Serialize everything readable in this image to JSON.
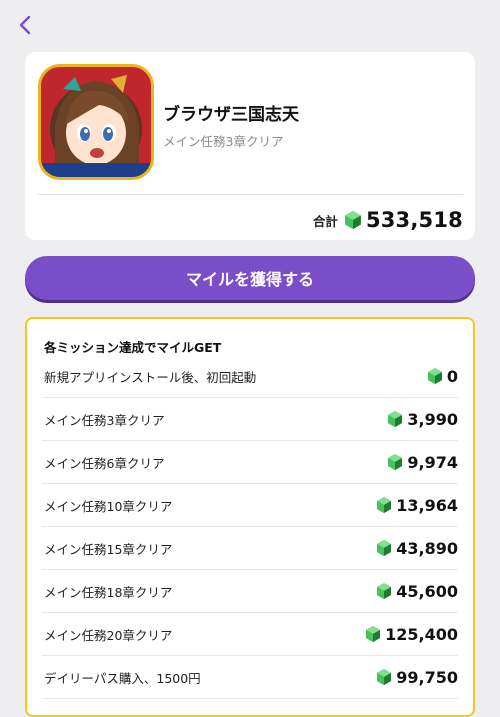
{
  "app": {
    "name": "ブラウザ三国志天",
    "subtitle": "メイン任務3章クリア",
    "total_label": "合計",
    "total_value": "533,518"
  },
  "earn_button": {
    "label": "マイルを獲得する"
  },
  "missions": {
    "title": "各ミッション達成でマイルGET",
    "items": [
      {
        "label": "新規アプリインストール後、初回起動",
        "value": "0"
      },
      {
        "label": "メイン任務3章クリア",
        "value": "3,990"
      },
      {
        "label": "メイン任務6章クリア",
        "value": "9,974"
      },
      {
        "label": "メイン任務10章クリア",
        "value": "13,964"
      },
      {
        "label": "メイン任務15章クリア",
        "value": "43,890"
      },
      {
        "label": "メイン任務18章クリア",
        "value": "45,600"
      },
      {
        "label": "メイン任務20章クリア",
        "value": "125,400"
      },
      {
        "label": "デイリーパス購入、1500円",
        "value": "99,750"
      }
    ]
  },
  "colors": {
    "accent_purple": "#7a4dc9",
    "mission_border": "#f2c81c",
    "gem_green": "#3fbf55"
  },
  "icons": {
    "back": "chevron-left-icon",
    "currency": "green-gem-icon"
  }
}
